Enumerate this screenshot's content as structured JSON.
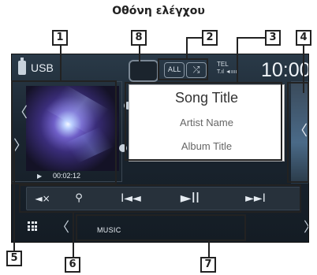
{
  "page_heading": "Οθόνη ελέγχου",
  "top_bar": {
    "source_label": "USB",
    "repeat_label": "ALL",
    "tel_label": "TEL",
    "tel_sub": "T.ıl ◄ıııı",
    "clock": "10:00"
  },
  "track": {
    "song_title": "Song Title",
    "artist_name": "Artist Name",
    "album_title": "Album Title",
    "elapsed_time": "00:02:12"
  },
  "controls": {
    "mute_icon": "◄×",
    "search_icon": "⚲",
    "prev_icon": "I◄◄",
    "playpause_icon": "►II",
    "next_icon": "►►I"
  },
  "bottom_bar": {
    "music_label": "MUSIC"
  },
  "callouts": [
    "1",
    "2",
    "3",
    "4",
    "5",
    "6",
    "7",
    "8"
  ],
  "icons": {
    "chevron_left": "〈",
    "chevron_right": "〉",
    "play_mini": "▶"
  }
}
